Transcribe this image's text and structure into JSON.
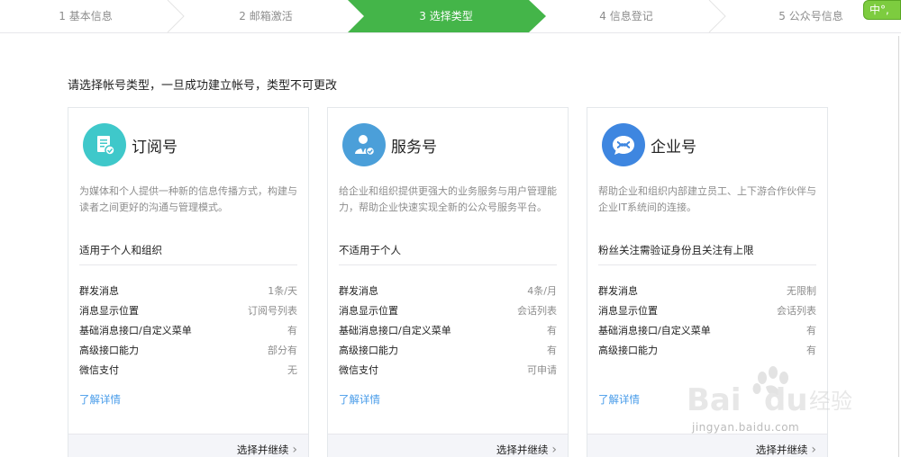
{
  "steps": [
    {
      "label": "1 基本信息"
    },
    {
      "label": "2 邮箱激活"
    },
    {
      "label": "3 选择类型"
    },
    {
      "label": "4 信息登记"
    },
    {
      "label": "5 公众号信息"
    }
  ],
  "lang_badge": "中°,",
  "intro": "请选择帐号类型，一旦成功建立帐号，类型不可更改",
  "cards": [
    {
      "title": "订阅号",
      "icon": "document-check-icon",
      "icon_color": "#3fc8ca",
      "desc": "为媒体和个人提供一种新的信息传播方式，构建与读者之间更好的沟通与管理模式。",
      "suit": "适用于个人和组织",
      "features": [
        {
          "k": "群发消息",
          "v": "1条/天"
        },
        {
          "k": "消息显示位置",
          "v": "订阅号列表"
        },
        {
          "k": "基础消息接口/自定义菜单",
          "v": "有"
        },
        {
          "k": "高级接口能力",
          "v": "部分有"
        },
        {
          "k": "微信支付",
          "v": "无"
        }
      ],
      "more": "了解详情",
      "go": "选择并继续"
    },
    {
      "title": "服务号",
      "icon": "service-person-icon",
      "icon_color": "#4b9fd9",
      "desc": "给企业和组织提供更强大的业务服务与用户管理能力，帮助企业快速实现全新的公众号服务平台。",
      "suit": "不适用于个人",
      "features": [
        {
          "k": "群发消息",
          "v": "4条/月"
        },
        {
          "k": "消息显示位置",
          "v": "会话列表"
        },
        {
          "k": "基础消息接口/自定义菜单",
          "v": "有"
        },
        {
          "k": "高级接口能力",
          "v": "有"
        },
        {
          "k": "微信支付",
          "v": "可申请"
        }
      ],
      "more": "了解详情",
      "go": "选择并继续"
    },
    {
      "title": "企业号",
      "icon": "enterprise-chat-icon",
      "icon_color": "#3e86e0",
      "desc": "帮助企业和组织内部建立员工、上下游合作伙伴与企业IT系统间的连接。",
      "suit": "粉丝关注需验证身份且关注有上限",
      "features": [
        {
          "k": "群发消息",
          "v": "无限制"
        },
        {
          "k": "消息显示位置",
          "v": "会话列表"
        },
        {
          "k": "基础消息接口/自定义菜单",
          "v": "有"
        },
        {
          "k": "高级接口能力",
          "v": "有"
        }
      ],
      "more": "了解详情",
      "go": "选择并继续"
    }
  ],
  "watermark": {
    "brand": "Bai",
    "brand2": "du",
    "cn": "经验",
    "url": "jingyan.baidu.com"
  },
  "colors": {
    "active_step": "#44b549",
    "link": "#459ae9"
  }
}
